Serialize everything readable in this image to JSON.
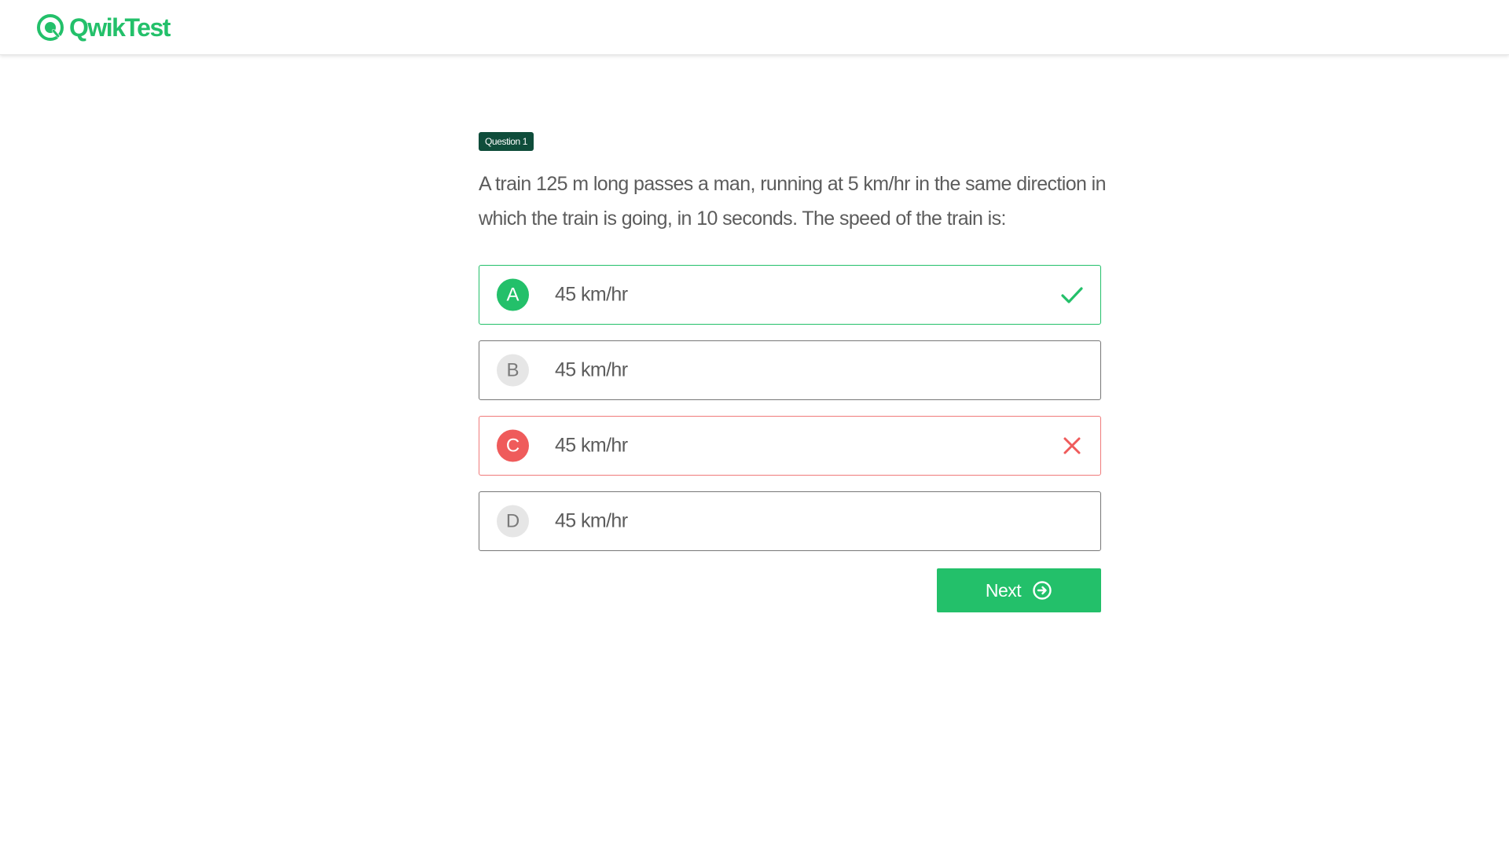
{
  "header": {
    "brand_name": "QwikTest",
    "logo_icon": "qwiktest-logo-icon"
  },
  "question": {
    "badge": "Question 1",
    "text": "A train 125 m long passes a man, running at 5 km/hr in the same direction in which the train is going, in 10 seconds. The speed of the train is:"
  },
  "options": [
    {
      "letter": "A",
      "label": "45 km/hr",
      "state": "correct",
      "icon": "check-icon"
    },
    {
      "letter": "B",
      "label": "45 km/hr",
      "state": "neutral"
    },
    {
      "letter": "C",
      "label": "45 km/hr",
      "state": "wrong",
      "icon": "close-icon"
    },
    {
      "letter": "D",
      "label": "45 km/hr",
      "state": "neutral"
    }
  ],
  "actions": {
    "next_label": "Next",
    "next_icon": "arrow-right-circle-icon"
  },
  "colors": {
    "brand_green": "#23c06a",
    "badge_dark_green": "#0f4d3b",
    "wrong_red": "#ef5b5b",
    "neutral_border": "#777777"
  }
}
